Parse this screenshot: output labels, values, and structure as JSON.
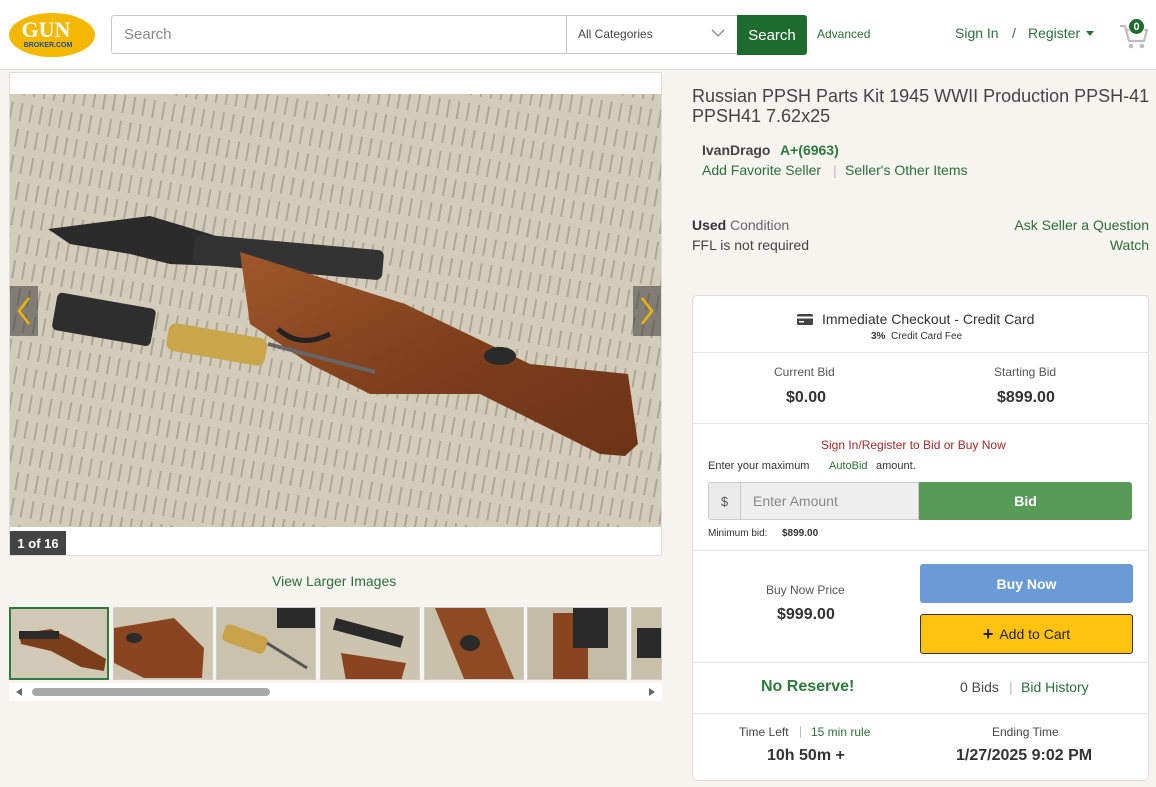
{
  "header": {
    "logo_text_top": "GUN",
    "logo_text_bottom": "BROKER.COM",
    "search_placeholder": "Search",
    "category_selected": "All Categories",
    "search_button": "Search",
    "advanced_link": "Advanced",
    "sign_in": "Sign In",
    "separator": "/",
    "register": "Register",
    "cart_count": "0",
    "brand_color": "#1e6b2e",
    "logo_color": "#f5b800"
  },
  "gallery": {
    "counter": "1 of 16",
    "view_larger": "View Larger Images",
    "thumbnail_count": 7
  },
  "listing": {
    "title": "Russian PPSH Parts Kit 1945 WWII Production PPSH-41 PPSH41 7.62x25",
    "seller_name": "IvanDrago",
    "seller_rating": "A+(6963)",
    "add_favorite": "Add Favorite Seller",
    "separator": "|",
    "other_items": "Seller's Other Items",
    "condition_value": "Used",
    "condition_label": "Condition",
    "ffl": "FFL is not required",
    "ask_seller": "Ask Seller a Question",
    "watch": "Watch"
  },
  "checkout": {
    "title": "Immediate Checkout - Credit Card",
    "fee_pct": "3%",
    "fee_text": "Credit Card Fee"
  },
  "bidding": {
    "current_bid_label": "Current Bid",
    "current_bid": "$0.00",
    "starting_bid_label": "Starting Bid",
    "starting_bid": "$899.00",
    "signin_prompt": "Sign In/Register to Bid or Buy Now",
    "autobid_pre": "Enter your maximum",
    "autobid_link": "AutoBid",
    "autobid_post": "amount.",
    "currency": "$",
    "amount_placeholder": "Enter Amount",
    "bid_button": "Bid",
    "min_bid_label": "Minimum bid:",
    "min_bid_value": "$899.00"
  },
  "buynow": {
    "label": "Buy Now Price",
    "price": "$999.00",
    "buy_button": "Buy Now",
    "cart_button": "Add to Cart"
  },
  "status": {
    "no_reserve": "No Reserve!",
    "bids": "0 Bids",
    "separator": "|",
    "bid_history": "Bid History",
    "time_left_label": "Time Left",
    "rule_link": "15 min rule",
    "time_left": "10h 50m +",
    "ending_label": "Ending Time",
    "ending_time": "1/27/2025 9:02 PM"
  }
}
